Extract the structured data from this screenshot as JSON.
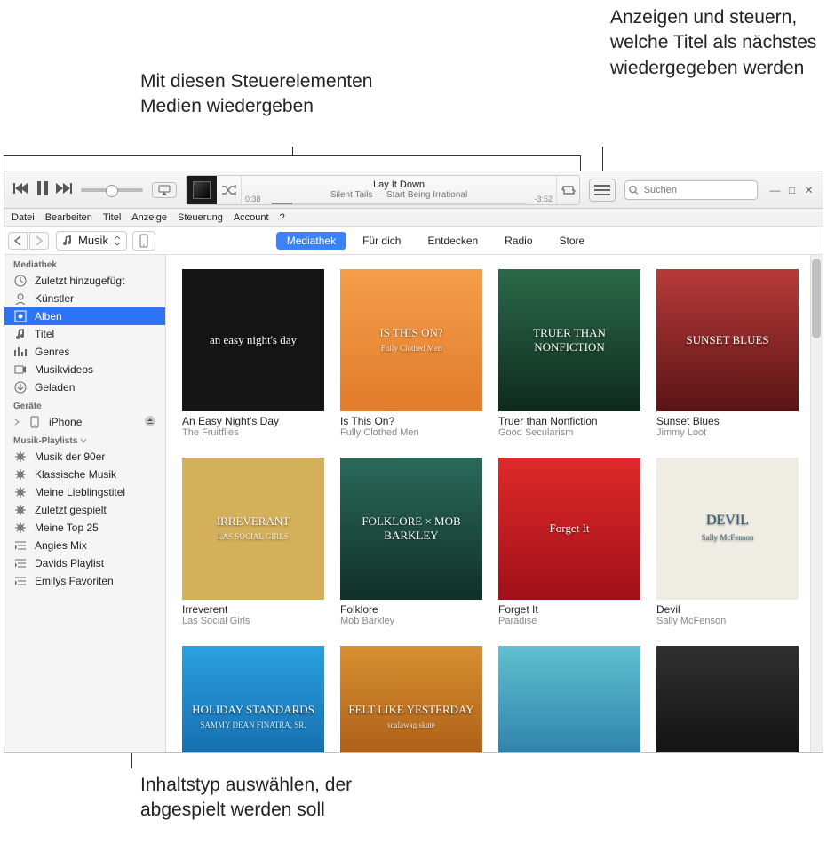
{
  "annotations": {
    "top_left": "Mit diesen Steuerelementen Medien wiedergeben",
    "top_right": "Anzeigen und steuern, welche Titel als nächstes wiedergegeben werden",
    "bottom": "Inhaltstyp auswählen, der abgespielt werden soll"
  },
  "player": {
    "track_title": "Lay It Down",
    "track_subtitle": "Silent Tails — Start Being Irrational",
    "time_elapsed": "0:38",
    "time_remaining": "-3:52"
  },
  "search": {
    "placeholder": "Suchen"
  },
  "menubar": [
    "Datei",
    "Bearbeiten",
    "Titel",
    "Anzeige",
    "Steuerung",
    "Account",
    "?"
  ],
  "media_select": {
    "label": "Musik"
  },
  "tabs": [
    {
      "label": "Mediathek",
      "active": true
    },
    {
      "label": "Für dich",
      "active": false
    },
    {
      "label": "Entdecken",
      "active": false
    },
    {
      "label": "Radio",
      "active": false
    },
    {
      "label": "Store",
      "active": false
    }
  ],
  "sidebar": {
    "library_head": "Mediathek",
    "library": [
      {
        "label": "Zuletzt hinzugefügt",
        "icon": "clock"
      },
      {
        "label": "Künstler",
        "icon": "person"
      },
      {
        "label": "Alben",
        "icon": "album",
        "selected": true
      },
      {
        "label": "Titel",
        "icon": "note"
      },
      {
        "label": "Genres",
        "icon": "genres"
      },
      {
        "label": "Musikvideos",
        "icon": "video"
      },
      {
        "label": "Geladen",
        "icon": "download"
      }
    ],
    "devices_head": "Geräte",
    "devices": [
      {
        "label": "iPhone",
        "icon": "phone",
        "eject": true
      }
    ],
    "playlists_head": "Musik-Playlists",
    "playlists": [
      {
        "label": "Musik der 90er",
        "icon": "gear"
      },
      {
        "label": "Klassische Musik",
        "icon": "gear"
      },
      {
        "label": "Meine Lieblingstitel",
        "icon": "gear"
      },
      {
        "label": "Zuletzt gespielt",
        "icon": "gear"
      },
      {
        "label": "Meine Top 25",
        "icon": "gear"
      },
      {
        "label": "Angies Mix",
        "icon": "list"
      },
      {
        "label": "Davids Playlist",
        "icon": "list"
      },
      {
        "label": "Emilys Favoriten",
        "icon": "list"
      }
    ]
  },
  "albums": [
    {
      "title": "An Easy Night's Day",
      "artist": "The Fruitflies",
      "art_text": "an easy night's day",
      "art_class": "art1"
    },
    {
      "title": "Is This On?",
      "artist": "Fully Clothed Men",
      "art_text": "IS THIS ON?",
      "art_sub": "Fully Clothed Men",
      "art_class": "art2"
    },
    {
      "title": "Truer than Nonfiction",
      "artist": "Good Secularism",
      "art_text": "TRUER THAN NONFICTION",
      "art_class": "art3"
    },
    {
      "title": "Sunset Blues",
      "artist": "Jimmy Loot",
      "art_text": "SUNSET BLUES",
      "art_class": "art4"
    },
    {
      "title": "Irreverent",
      "artist": "Las Social Girls",
      "art_text": "IRREVERANT",
      "art_sub": "LAS SOCIAL GIRLS",
      "art_class": "art5"
    },
    {
      "title": "Folklore",
      "artist": "Mob Barkley",
      "art_text": "FOLKLORE × MOB BARKLEY",
      "art_class": "art6"
    },
    {
      "title": "Forget It",
      "artist": "Paradise",
      "art_text": "Forget It",
      "art_class": "art7"
    },
    {
      "title": "Devil",
      "artist": "Sally McFenson",
      "art_text": "DEVIL",
      "art_sub": "Sally McFenson",
      "art_class": "art8"
    },
    {
      "title": "",
      "artist": "",
      "art_text": "HOLIDAY STANDARDS",
      "art_sub": "SAMMY DEAN FINATRA, SR.",
      "art_class": "art9"
    },
    {
      "title": "",
      "artist": "",
      "art_text": "FELT LIKE YESTERDAY",
      "art_sub": "scalawag skate",
      "art_class": "art10"
    },
    {
      "title": "",
      "artist": "",
      "art_text": "",
      "art_class": "art11"
    },
    {
      "title": "",
      "artist": "",
      "art_text": "",
      "art_class": "art12"
    }
  ]
}
